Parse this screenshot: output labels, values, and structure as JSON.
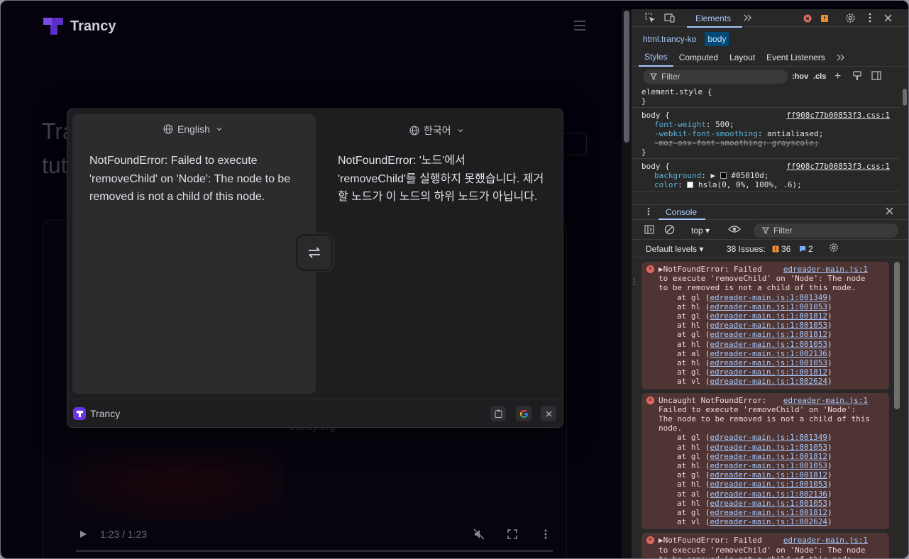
{
  "page": {
    "brand": "Trancy",
    "bg_title_line1": "Tra",
    "bg_title_line2": "tut",
    "site_url": "trancy.org",
    "video_time": "1:23 / 1:23"
  },
  "popup": {
    "source_lang": "English",
    "target_lang": "한국어",
    "source_text": "NotFoundError: Failed to execute 'removeChild' on 'Node': The node to be removed is not a child of this node.",
    "target_text": "NotFoundError: '노드'에서 'removeChild'를 실행하지 못했습니다. 제거할 노드가 이 노드의 하위 노드가 아닙니다.",
    "footer_brand": "Trancy",
    "brand_color": "#6a35e8"
  },
  "devtools": {
    "main_tab": "Elements",
    "breadcrumbs": [
      "html.trancy-ko",
      "body"
    ],
    "subtabs": [
      "Styles",
      "Computed",
      "Layout",
      "Event Listeners"
    ],
    "filter_placeholder": "Filter",
    "hov": ":hov",
    "cls": ".cls",
    "element_style": "element.style {",
    "close_brace": "}",
    "rules": [
      {
        "selector": "body {",
        "source": "ff908c77b00853f3.css:1",
        "props": [
          {
            "name": "font-weight",
            "value": "500;",
            "struck": false
          },
          {
            "name": "-webkit-font-smoothing",
            "value": "antialiased;",
            "struck": false
          },
          {
            "name": "-moz-osx-font-smoothing",
            "value": "grayscale;",
            "struck": true
          }
        ]
      },
      {
        "selector": "body {",
        "source": "ff908c77b00853f3.css:1",
        "props": [
          {
            "name": "background",
            "value": "#05010d;",
            "struck": false
          },
          {
            "name": "color",
            "value": "hsla(0, 0%, 100%, .6);",
            "struck": false
          }
        ]
      }
    ],
    "console_tab": "Console",
    "context": "top",
    "console_filter": "Filter",
    "default_levels": "Default levels",
    "issues_label": "38 Issues:",
    "issues_warn": "36",
    "issues_info": "2",
    "messages": [
      {
        "lines": [
          "▶NotFoundError: Failed",
          "to execute 'removeChild' on 'Node': The node",
          "to be removed is not a child of this node."
        ],
        "source": "edreader-main.js:1",
        "stack": [
          [
            "gl",
            "edreader-main.js:1:801349"
          ],
          [
            "hl",
            "edreader-main.js:1:801053"
          ],
          [
            "gl",
            "edreader-main.js:1:801812"
          ],
          [
            "hl",
            "edreader-main.js:1:801053"
          ],
          [
            "gl",
            "edreader-main.js:1:801812"
          ],
          [
            "hl",
            "edreader-main.js:1:801053"
          ],
          [
            "al",
            "edreader-main.js:1:802136"
          ],
          [
            "hl",
            "edreader-main.js:1:801053"
          ],
          [
            "gl",
            "edreader-main.js:1:801812"
          ],
          [
            "vl",
            "edreader-main.js:1:802624"
          ]
        ]
      },
      {
        "lines": [
          "Uncaught NotFoundError:",
          "Failed to execute 'removeChild' on 'Node':",
          "The node to be removed is not a child of this",
          "node."
        ],
        "source": "edreader-main.js:1",
        "stack": [
          [
            "gl",
            "edreader-main.js:1:801349"
          ],
          [
            "hl",
            "edreader-main.js:1:801053"
          ],
          [
            "gl",
            "edreader-main.js:1:801812"
          ],
          [
            "hl",
            "edreader-main.js:1:801053"
          ],
          [
            "gl",
            "edreader-main.js:1:801812"
          ],
          [
            "hl",
            "edreader-main.js:1:801053"
          ],
          [
            "al",
            "edreader-main.js:1:802136"
          ],
          [
            "hl",
            "edreader-main.js:1:801053"
          ],
          [
            "gl",
            "edreader-main.js:1:801812"
          ],
          [
            "vl",
            "edreader-main.js:1:802624"
          ]
        ]
      },
      {
        "lines": [
          "▶NotFoundError: Failed",
          "to execute 'removeChild' on 'Node': The node",
          "to be removed is not a child of this node."
        ],
        "source": "edreader-main.js:1",
        "stack": []
      }
    ]
  }
}
